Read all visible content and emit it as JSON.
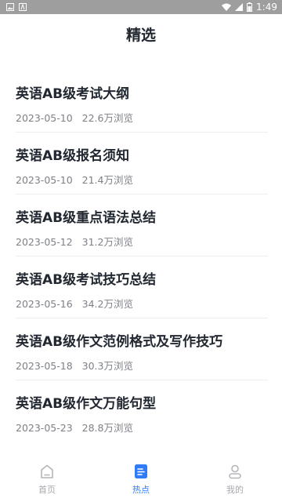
{
  "status_bar": {
    "time": "1:49"
  },
  "header": {
    "title": "精选"
  },
  "articles": [
    {
      "title": "英语AB级考试大纲",
      "date": "2023-05-10",
      "views": "22.6万浏览"
    },
    {
      "title": "英语AB级报名须知",
      "date": "2023-05-10",
      "views": "21.4万浏览"
    },
    {
      "title": "英语AB级重点语法总结",
      "date": "2023-05-12",
      "views": "31.2万浏览"
    },
    {
      "title": "英语AB级考试技巧总结",
      "date": "2023-05-16",
      "views": "34.2万浏览"
    },
    {
      "title": "英语AB级作文范例格式及写作技巧",
      "date": "2023-05-18",
      "views": "30.3万浏览"
    },
    {
      "title": "英语AB级作文万能句型",
      "date": "2023-05-23",
      "views": "28.8万浏览"
    }
  ],
  "tabbar": {
    "tabs": [
      {
        "label": "首页",
        "icon": "home-icon"
      },
      {
        "label": "热点",
        "icon": "document-icon",
        "active": true
      },
      {
        "label": "我的",
        "icon": "person-icon"
      }
    ]
  },
  "colors": {
    "accent": "#2f7cf6",
    "inactive": "#a6a9ae",
    "status_bar": "#9e9e9e"
  }
}
